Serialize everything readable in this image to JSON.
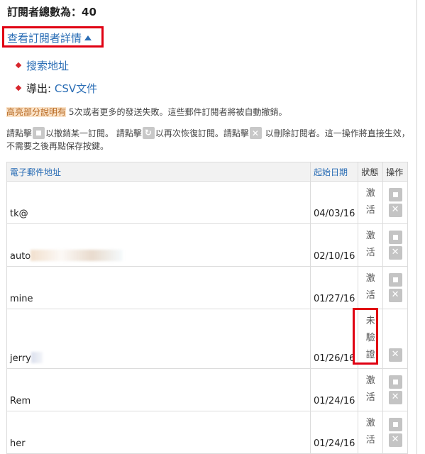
{
  "summary": {
    "total_label": "訂閱者總數為：40"
  },
  "toggle": {
    "label": "查看訂閱者詳情"
  },
  "links": {
    "search": "搜索地址",
    "export_prefix": "導出:",
    "export_csv": "CSV文件"
  },
  "notes": {
    "highlight": "高亮部分說明有",
    "highlight_rest": "5次或者更多的發送失敗。這些郵件訂閱者將被自動撤銷。",
    "click1": "請點擊",
    "unsub": "以撤銷某一訂閱。",
    "click2": "請點擊",
    "resub": "以再次恢復訂閱。請點擊",
    "delete": "以刪除訂閱者。這一操作將直接生效，不需要之後再點保存按鍵。"
  },
  "table": {
    "headers": {
      "email": "電子郵件地址",
      "date": "起始日期",
      "status": "狀態",
      "action": "操作"
    },
    "rows": [
      {
        "email": "tk@",
        "date": "04/03/16",
        "status": "激活",
        "blur": 0
      },
      {
        "email": "auto",
        "date": "02/10/16",
        "status": "激活",
        "blur": 1
      },
      {
        "email": "mine",
        "date": "01/27/16",
        "status": "激活",
        "blur": 0
      },
      {
        "email": "jerry",
        "date": "01/26/16",
        "status": "未驗證",
        "blur": 2
      },
      {
        "email": "Rem",
        "date": "01/24/16",
        "status": "激活",
        "blur": 0
      },
      {
        "email": "her",
        "date": "01/24/16",
        "status": "激活",
        "blur": 0
      }
    ]
  }
}
